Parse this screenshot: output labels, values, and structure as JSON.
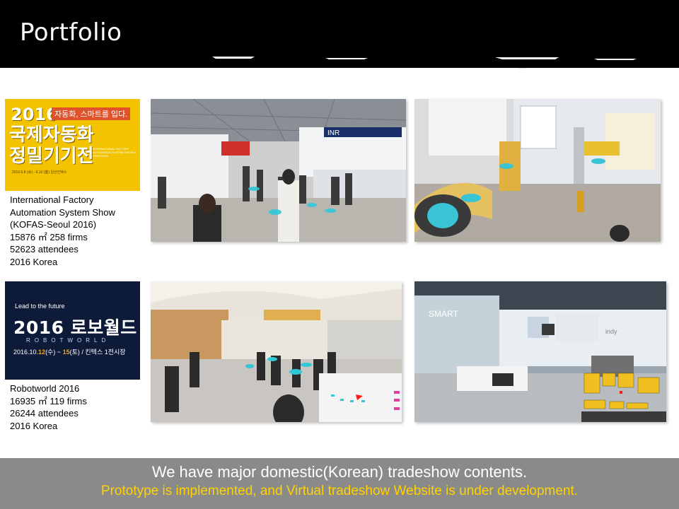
{
  "header": {
    "title": "Portfolio"
  },
  "shows": [
    {
      "poster": {
        "year": "2016",
        "tagline": "자동화, 스마트를 입다.",
        "main_line1": "국제자동화",
        "main_line2": "정밀기기전",
        "sub": "INTERNATIONAL FACTORY AUTOMATION SYSTEM SHOW & PRECISION",
        "date": "2016.6.8 (水) - 6.10 (金) 일산킨텍스"
      },
      "caption": [
        "International Factory",
        "Automation System Show",
        "(KOFAS-Seoul 2016)",
        "15876 ㎡ 258 firms",
        "52623 attendees",
        "2016 Korea"
      ]
    },
    {
      "poster": {
        "lead": "Lead to the future",
        "title": "2016 로보월드",
        "robo": "ROBOTWORLD",
        "date_prefix": "2016.10.",
        "date_hl1": "12",
        "date_mid": "(수) ~ ",
        "date_hl2": "15",
        "date_suffix": "(토) / 킨텍스 1전시장"
      },
      "caption": [
        "Robotworld 2016",
        "16935 ㎡ 119 firms",
        "26244 attendees",
        "2016 Korea"
      ]
    }
  ],
  "photos": {
    "booth_sign_1": "INR",
    "booth_sign_2": "SMART",
    "booth_sign_3": "indy"
  },
  "footer": {
    "line1": "We have major domestic(Korean)  tradeshow contents.",
    "line2": "Prototype is implemented, and Virtual tradeshow Website is under development."
  },
  "colors": {
    "header_bg": "#000000",
    "footer_bg": "#8a8a8a",
    "footer_highlight": "#ffd200",
    "hotspot": "#30c8d8"
  }
}
